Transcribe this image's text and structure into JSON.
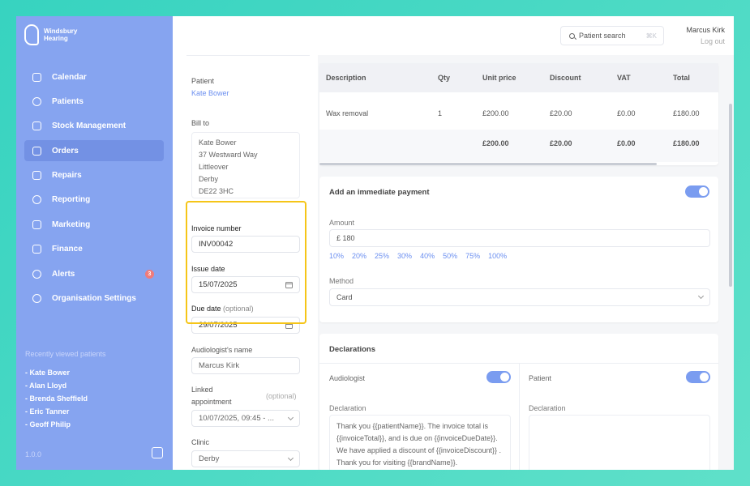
{
  "brand": {
    "line1": "Windsbury",
    "line2": "Hearing"
  },
  "nav": [
    {
      "label": "Calendar",
      "icon": "calendar-icon"
    },
    {
      "label": "Patients",
      "icon": "patients-icon"
    },
    {
      "label": "Stock Management",
      "icon": "stock-icon"
    },
    {
      "label": "Orders",
      "icon": "orders-icon",
      "active": true
    },
    {
      "label": "Repairs",
      "icon": "wrench-icon"
    },
    {
      "label": "Reporting",
      "icon": "chart-icon"
    },
    {
      "label": "Marketing",
      "icon": "mail-icon"
    },
    {
      "label": "Finance",
      "icon": "card-icon"
    },
    {
      "label": "Alerts",
      "icon": "bell-icon",
      "badge": "3"
    },
    {
      "label": "Organisation Settings",
      "icon": "gear-icon"
    }
  ],
  "recent": {
    "title": "Recently viewed patients",
    "items": [
      "- Kate Bower",
      "- Alan Lloyd",
      "- Brenda Sheffield",
      "- Eric Tanner",
      "- Geoff Philip"
    ]
  },
  "version": "1.0.0",
  "header": {
    "search_label": "Patient search",
    "shortcut": "⌘K",
    "user_name": "Marcus Kirk",
    "logout": "Log out"
  },
  "form": {
    "patient_label": "Patient",
    "patient_value": "Kate Bower",
    "bill_to_label": "Bill to",
    "address": [
      "Kate Bower",
      "37 Westward Way",
      "Littleover",
      "Derby",
      "DE22 3HC"
    ],
    "invoice_number_label": "Invoice number",
    "invoice_number": "INV00042",
    "issue_date_label": "Issue date",
    "issue_date": "15/07/2025",
    "due_date_label": "Due date",
    "due_date_optional": "(optional)",
    "due_date": "29/07/2025",
    "audiologist_label": "Audiologist's name",
    "audiologist_value": "Marcus Kirk",
    "linked_label_1": "Linked",
    "linked_label_2": "appointment",
    "linked_optional": "(optional)",
    "linked_value": "10/07/2025, 09:45 - ...",
    "clinic_label": "Clinic",
    "clinic_value": "Derby"
  },
  "table": {
    "headers": [
      "Description",
      "Qty",
      "Unit price",
      "Discount",
      "VAT",
      "Total"
    ],
    "row": [
      "Wax removal",
      "1",
      "£200.00",
      "£20.00",
      "£0.00",
      "£180.00"
    ],
    "totals": [
      "£200.00",
      "£20.00",
      "£0.00",
      "£180.00"
    ]
  },
  "payment": {
    "title": "Add an immediate payment",
    "amount_label": "Amount",
    "amount_value": "£ 180",
    "percentages": [
      "10%",
      "20%",
      "25%",
      "30%",
      "40%",
      "50%",
      "75%",
      "100%"
    ],
    "method_label": "Method",
    "method_value": "Card"
  },
  "declarations": {
    "title": "Declarations",
    "audiologist_label": "Audiologist",
    "patient_label": "Patient",
    "declaration_label": "Declaration",
    "audiologist_text": "Thank you {{patientName}}. The invoice total is {{invoiceTotal}}, and is due on {{invoiceDueDate}}. We have applied a discount of {{invoiceDiscount}} . Thank you for visiting {{brandName}}.",
    "patient_text": ""
  }
}
